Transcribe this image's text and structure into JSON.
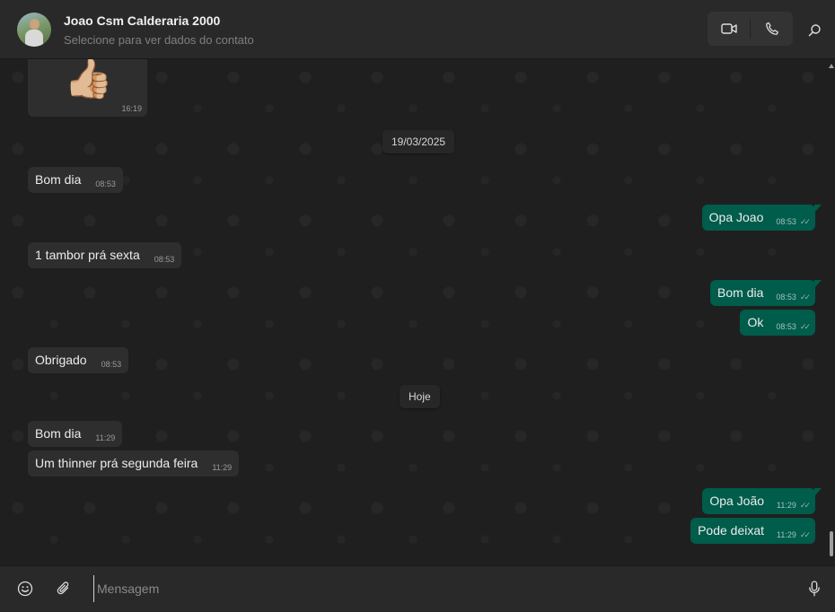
{
  "header": {
    "contact_name": "Joao Csm Calderaria 2000",
    "contact_subtitle": "Selecione para ver dados do contato",
    "icons": {
      "video": "video-camera-icon",
      "phone": "phone-icon",
      "search": "search-icon"
    }
  },
  "chat": {
    "sticker": {
      "emoji": "👍🏼",
      "time": "16:19"
    },
    "dates": {
      "d1": "19/03/2025",
      "d2": "Hoje"
    },
    "messages": [
      {
        "direction": "in",
        "text": "Bom dia",
        "time": "08:53"
      },
      {
        "direction": "out",
        "text": "Opa Joao",
        "time": "08:53",
        "ticks": "✓✓"
      },
      {
        "direction": "in",
        "text": "1 tambor prá sexta",
        "time": "08:53"
      },
      {
        "direction": "out",
        "text": "Bom dia",
        "time": "08:53",
        "ticks": "✓✓"
      },
      {
        "direction": "out",
        "text": "Ok",
        "time": "08:53",
        "ticks": "✓✓"
      },
      {
        "direction": "in",
        "text": "Obrigado",
        "time": "08:53"
      },
      {
        "direction": "in",
        "text": "Bom dia",
        "time": "11:29"
      },
      {
        "direction": "in",
        "text": "Um thinner prá segunda feira",
        "time": "11:29"
      },
      {
        "direction": "out",
        "text": "Opa João",
        "time": "11:29",
        "ticks": "✓✓"
      },
      {
        "direction": "out",
        "text": "Pode deixat",
        "time": "11:29",
        "ticks": "✓✓"
      }
    ]
  },
  "composer": {
    "placeholder": "Mensagem",
    "icons": {
      "emoji": "smiley-icon",
      "attach": "paperclip-icon",
      "mic": "microphone-icon"
    }
  },
  "colors": {
    "outgoing_bubble": "#005c4b",
    "incoming_bubble": "#2e2e2e",
    "background": "#1f1f1f"
  }
}
